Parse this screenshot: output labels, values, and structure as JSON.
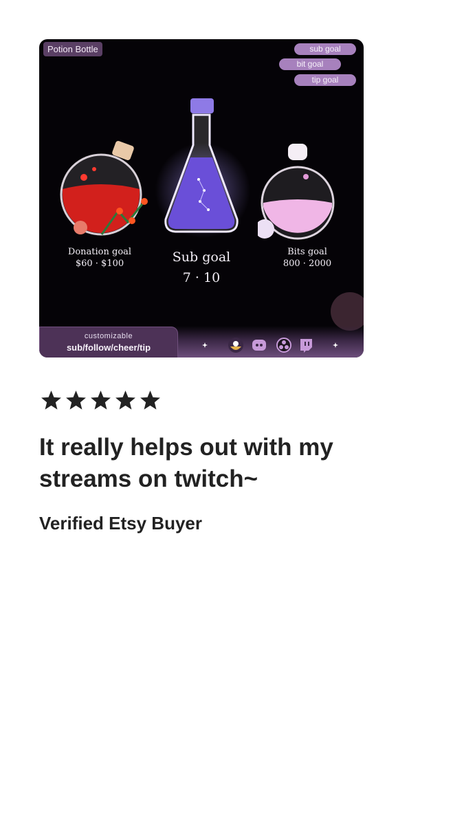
{
  "product_image": {
    "tag": "Potion Bottle",
    "goal_pills": [
      "sub goal",
      "bit goal",
      "tip goal"
    ],
    "bottles": {
      "donation": {
        "title": "Donation goal",
        "value": "$60 · $100"
      },
      "sub": {
        "title": "Sub goal",
        "value": "7 · 10"
      },
      "bits": {
        "title": "Bits goal",
        "value": "800 · 2000"
      }
    },
    "customizable_small": "customizable",
    "customizable_big": "sub/follow/cheer/tip",
    "platform_icons": [
      "sparkle-icon",
      "streamlabs-icon",
      "discord-icon",
      "obs-icon",
      "twitch-icon",
      "sparkle-icon"
    ]
  },
  "review": {
    "rating": 5,
    "rating_max": 5,
    "text": "It really helps out with my streams on twitch~",
    "author": "Verified Etsy Buyer"
  },
  "colors": {
    "star": "#222222",
    "text": "#222222",
    "card_bg": "#050307",
    "pill": "#a781bd",
    "red_potion": "#d2201c",
    "purple_potion": "#6a4fd8",
    "pink_potion": "#f0b6e6"
  }
}
